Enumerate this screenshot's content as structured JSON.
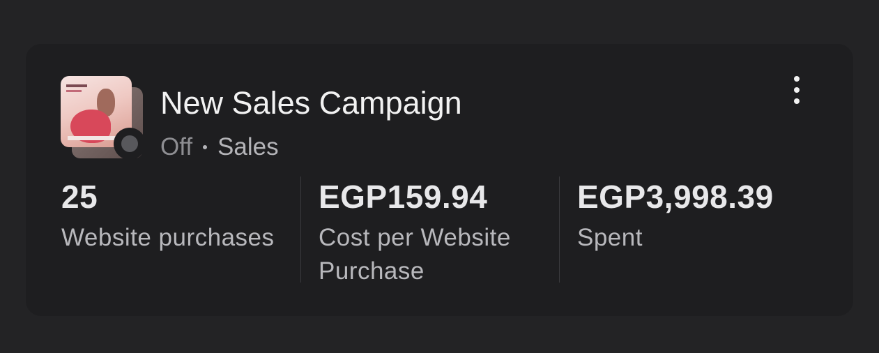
{
  "campaign": {
    "name": "New Sales Campaign",
    "status": "Off",
    "objective": "Sales",
    "thumbnail_icon": "campaign-thumbnail-image",
    "status_color": "#58585c"
  },
  "menu": {
    "icon": "more-vertical-icon"
  },
  "metrics": [
    {
      "value": "25",
      "label": "Website purchases"
    },
    {
      "value": "EGP159.94",
      "label": "Cost per Website Purchase"
    },
    {
      "value": "EGP3,998.39",
      "label": "Spent"
    }
  ],
  "colors": {
    "background": "#232325",
    "card": "#1e1e20",
    "title": "#f2f2f2",
    "muted": "#8e8e92"
  }
}
